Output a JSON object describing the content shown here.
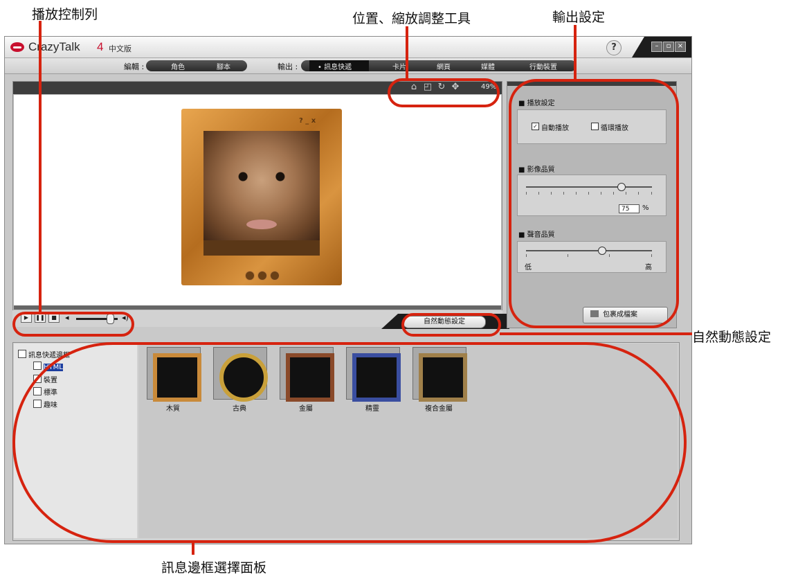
{
  "annotations": {
    "playback_bar": "播放控制列",
    "position_zoom_tools": "位置、縮放調整工具",
    "output_settings": "輸出設定",
    "natural_motion_settings": "自然動態設定",
    "frame_selection_panel": "訊息邊框選擇面板"
  },
  "colors": {
    "callout_red": "#d6230f",
    "brand_red": "#c8102e"
  },
  "titlebar": {
    "app_name": "CrazyTalk",
    "app_version": "4",
    "edition": "中文版",
    "help_label": "?"
  },
  "menubar": {
    "edit_label": "編輯 :",
    "edit_items": [
      "角色",
      "腳本"
    ],
    "output_label": "輸出 :",
    "output_items": [
      "訊息快遞",
      "卡片",
      "網頁",
      "媒體",
      "行動裝置"
    ],
    "active_output": "訊息快遞"
  },
  "preview": {
    "zoom_level": "49%",
    "tool_icons": [
      "home-icon",
      "fit-icon",
      "rotate-icon",
      "move-icon"
    ],
    "frame_controls": [
      "?",
      "_",
      "x"
    ]
  },
  "playback": {
    "controls": [
      "play-icon",
      "pause-icon",
      "stop-icon"
    ],
    "volume": 0.8,
    "natural_motion_button": "自然動態設定"
  },
  "output_panel": {
    "playback_settings_title": "播放設定",
    "autoplay_label": "自動播放",
    "autoplay_checked": true,
    "loop_label": "循環播放",
    "loop_checked": false,
    "image_quality_title": "影像品質",
    "image_quality_value": "75",
    "image_quality_unit": "%",
    "image_quality_level": 0.75,
    "audio_quality_title": "聲音品質",
    "audio_low_label": "低",
    "audio_high_label": "高",
    "audio_quality_level": 0.6,
    "pack_button": "包裹成檔案"
  },
  "library": {
    "tree_root": "訊息快遞邊框",
    "tree_items": [
      "HTML",
      "裝置",
      "標準",
      "趣味"
    ],
    "selected_tree_item": "HTML",
    "thumbnails": [
      {
        "label": "木質",
        "color": "#9a6a2a"
      },
      {
        "label": "古典",
        "color": "#b88a2a"
      },
      {
        "label": "金屬",
        "color": "#7a2418"
      },
      {
        "label": "精靈",
        "color": "#3a4ea0"
      },
      {
        "label": "複合金屬",
        "color": "#8a6a3a"
      }
    ]
  }
}
